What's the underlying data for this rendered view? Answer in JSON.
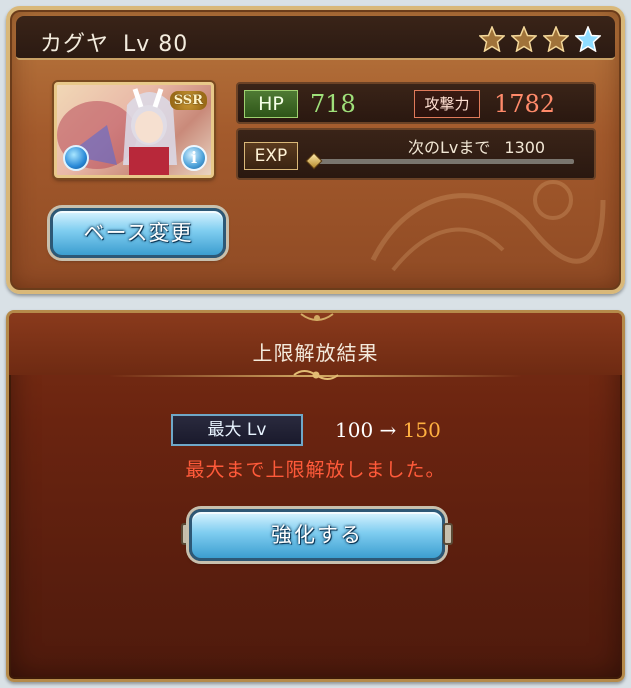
{
  "character": {
    "name": "カグヤ",
    "level_text": "Lv 80",
    "rarity": "SSR",
    "uncap_stars_total": 4,
    "uncap_stars_filled": 3,
    "hp_label": "HP",
    "hp_value": "718",
    "atk_label": "攻撃力",
    "atk_value": "1782",
    "exp_label": "EXP",
    "next_lv_label": "次のLvまで",
    "next_lv_value": "1300",
    "exp_progress": 0.0
  },
  "base_change_button": "ベース変更",
  "result": {
    "title": "上限解放結果",
    "max_lv_label": "最大 Lv",
    "lv_from": "100",
    "arrow": "→",
    "lv_to": "150",
    "message": "最大まで上限解放しました。",
    "enhance_button": "強化する"
  },
  "colors": {
    "hp": "#9fe07a",
    "atk": "#ff8a6a",
    "lv_to": "#ffb040",
    "message": "#ff5a3a"
  }
}
